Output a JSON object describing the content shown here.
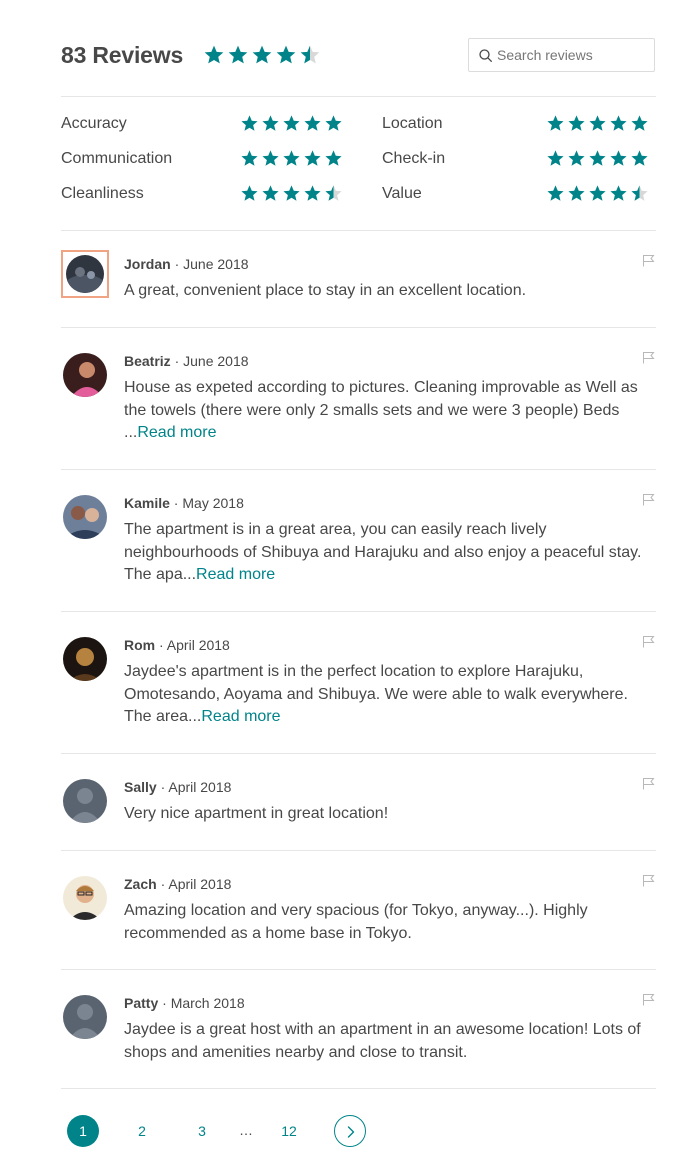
{
  "header": {
    "title": "83 Reviews",
    "overall_rating": 4.5,
    "search_placeholder": "Search reviews"
  },
  "colors": {
    "accent": "#008489",
    "star_empty": "#d8d8d8",
    "text": "#484848",
    "highlight_border": "#f0a484"
  },
  "categories": [
    {
      "label": "Accuracy",
      "rating": 5
    },
    {
      "label": "Location",
      "rating": 5
    },
    {
      "label": "Communication",
      "rating": 5
    },
    {
      "label": "Check-in",
      "rating": 5
    },
    {
      "label": "Cleanliness",
      "rating": 4.5
    },
    {
      "label": "Value",
      "rating": 4.5
    }
  ],
  "reviews": [
    {
      "name": "Jordan",
      "date": "June 2018",
      "text": "A great, convenient place to stay in an excellent location.",
      "read_more": "",
      "avatar": "photo-dark-scene"
    },
    {
      "name": "Beatriz",
      "date": "June 2018",
      "text": "House as expeted according to pictures. Cleaning improvable as Well as the towels (there were only 2 smalls sets and we were 3 people) Beds ...",
      "read_more": "Read more",
      "avatar": "photo-woman-pink"
    },
    {
      "name": "Kamile",
      "date": "May 2018",
      "text": "The apartment is in a great area, you can easily reach lively neighbourhoods of Shibuya and Harajuku and also enjoy a peaceful stay. The apa...",
      "read_more": "Read more",
      "avatar": "photo-couple"
    },
    {
      "name": "Rom",
      "date": "April 2018",
      "text": "Jaydee's apartment is in the perfect location to explore Harajuku, Omotesando, Aoyama and Shibuya. We were able to walk everywhere. The area...",
      "read_more": "Read more",
      "avatar": "photo-dark-warm"
    },
    {
      "name": "Sally",
      "date": "April 2018",
      "text": "Very nice apartment in great location!",
      "read_more": "",
      "avatar": "default-user"
    },
    {
      "name": "Zach",
      "date": "April 2018",
      "text": "Amazing location and very spacious (for Tokyo, anyway...). Highly recommended as a home base in Tokyo.",
      "read_more": "",
      "avatar": "photo-man-glasses"
    },
    {
      "name": "Patty",
      "date": "March 2018",
      "text": "Jaydee is a great host with an apartment in an awesome location! Lots of shops and amenities nearby and close to transit.",
      "read_more": "",
      "avatar": "default-user"
    }
  ],
  "pagination": {
    "pages": [
      "1",
      "2",
      "3",
      "12"
    ],
    "current": "1",
    "ellipsis": "…",
    "next_icon": "chevron-right-icon"
  }
}
